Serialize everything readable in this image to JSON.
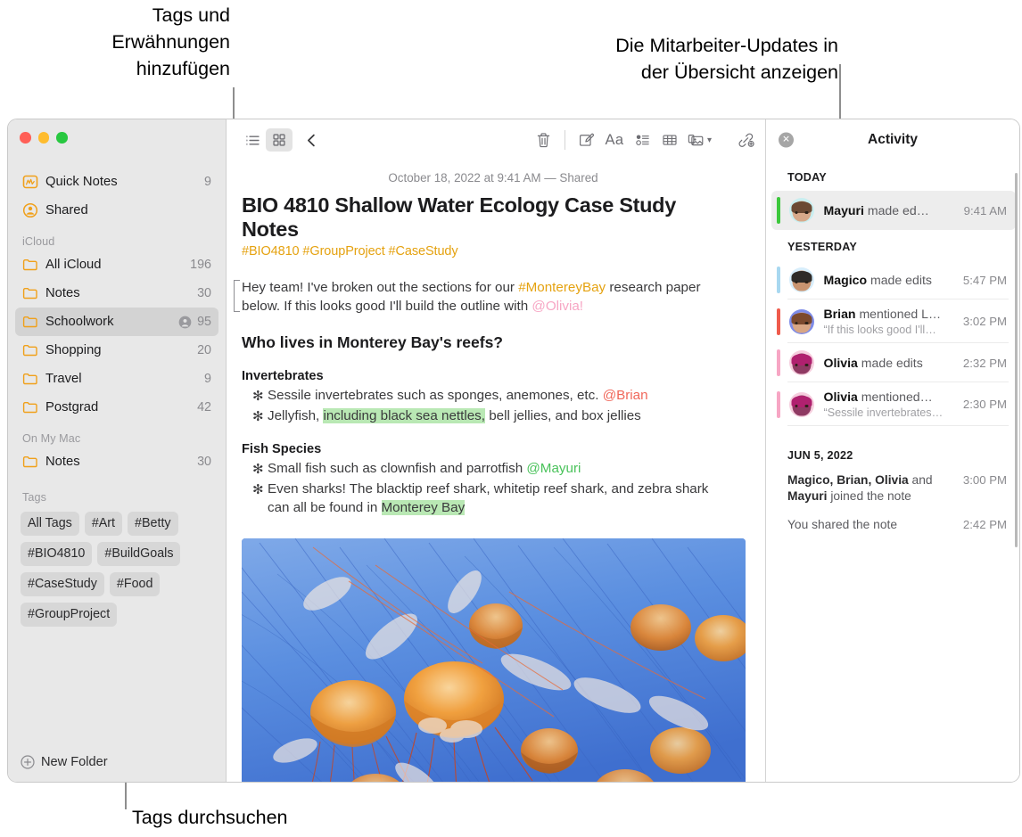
{
  "callouts": [
    {
      "id": "tags-mentions",
      "text": "Tags und\nErwähnungen\nhinzufügen"
    },
    {
      "id": "activity-overview",
      "text": "Die Mitarbeiter-Updates in\nder Übersicht anzeigen"
    },
    {
      "id": "browse-tags",
      "text": "Tags durchsuchen"
    }
  ],
  "window": {
    "traffic_lights": [
      "close",
      "minimize",
      "zoom"
    ]
  },
  "sidebar": {
    "top_items": [
      {
        "label": "Quick Notes",
        "count": "9",
        "icon": "quick-note-icon"
      },
      {
        "label": "Shared",
        "count": "",
        "icon": "shared-person-icon"
      }
    ],
    "groups": [
      {
        "title": "iCloud",
        "items": [
          {
            "label": "All iCloud",
            "count": "196",
            "icon": "folder-icon",
            "selected": false,
            "shared": false
          },
          {
            "label": "Notes",
            "count": "30",
            "icon": "folder-icon",
            "selected": false,
            "shared": false
          },
          {
            "label": "Schoolwork",
            "count": "95",
            "icon": "folder-icon",
            "selected": true,
            "shared": true
          },
          {
            "label": "Shopping",
            "count": "20",
            "icon": "folder-icon",
            "selected": false,
            "shared": false
          },
          {
            "label": "Travel",
            "count": "9",
            "icon": "folder-icon",
            "selected": false,
            "shared": false
          },
          {
            "label": "Postgrad",
            "count": "42",
            "icon": "folder-icon",
            "selected": false,
            "shared": false
          }
        ]
      },
      {
        "title": "On My Mac",
        "items": [
          {
            "label": "Notes",
            "count": "30",
            "icon": "folder-icon",
            "selected": false,
            "shared": false
          }
        ]
      }
    ],
    "tags_title": "Tags",
    "tags": [
      "All Tags",
      "#Art",
      "#Betty",
      "#BIO4810",
      "#BuildGoals",
      "#CaseStudy",
      "#Food",
      "#GroupProject"
    ],
    "new_folder_label": "New Folder"
  },
  "toolbar": {
    "left": [
      {
        "name": "list-view-icon",
        "active": false
      },
      {
        "name": "gallery-view-icon",
        "active": true
      },
      {
        "name": "back-chevron-icon",
        "active": false
      }
    ],
    "center": [
      {
        "name": "trash-icon"
      },
      {
        "name": "compose-icon"
      },
      {
        "name": "format-aa-icon",
        "label": "Aa"
      },
      {
        "name": "checklist-icon"
      },
      {
        "name": "table-icon"
      },
      {
        "name": "media-icon",
        "caret": true
      },
      {
        "name": "link-add-icon"
      }
    ],
    "right": [
      {
        "name": "lock-icon",
        "caret": true
      },
      {
        "name": "add-collaborator-icon"
      },
      {
        "name": "share-icon"
      },
      {
        "name": "search-icon"
      }
    ]
  },
  "note": {
    "date_line": "October 18, 2022 at 9:41 AM — Shared",
    "title": "BIO 4810 Shallow Water Ecology Case Study Notes",
    "tag_line": "#BIO4810 #GroupProject #CaseStudy",
    "intro": {
      "part1": "Hey team! I've broken out the sections for our ",
      "hashtag": "#MontereyBay",
      "part2": " research paper below. If this looks good I'll build the outline with ",
      "mention": "@Olivia!"
    },
    "heading": "Who lives in Monterey Bay's reefs?",
    "sections": [
      {
        "title": "Invertebrates",
        "bullets": [
          {
            "pre": "Sessile invertebrates such as sponges, anemones, etc. ",
            "mention": "@Brian",
            "mention_color": "red",
            "post": ""
          },
          {
            "pre": "Jellyfish, ",
            "highlight": "including black sea nettles,",
            "post": " bell jellies, and box jellies"
          }
        ]
      },
      {
        "title": "Fish Species",
        "bullets": [
          {
            "pre": "Small fish such as clownfish and parrotfish ",
            "mention": "@Mayuri",
            "mention_color": "green",
            "post": ""
          },
          {
            "pre": "Even sharks! The blacktip reef shark, whitetip reef shark, and zebra shark can all be found in ",
            "highlight": "Monterey Bay",
            "post": ""
          }
        ]
      }
    ],
    "image_alt": "jellyfish-photo"
  },
  "activity": {
    "title": "Activity",
    "close_icon": "close-icon",
    "sections": [
      {
        "label": "TODAY",
        "entries": [
          {
            "actor": "Mayuri",
            "action": " made ed…",
            "quote": "",
            "time": "9:41 AM",
            "bar_color": "#3cc83c",
            "avatar_bg": "#c9eef0",
            "avatar_skin": "#d7a98a",
            "avatar_hair": "#6b4a34",
            "selected": true
          }
        ]
      },
      {
        "label": "YESTERDAY",
        "entries": [
          {
            "actor": "Magico",
            "action": " made edits",
            "quote": "",
            "time": "5:47 PM",
            "bar_color": "#a8d8f0",
            "avatar_bg": "#d8eefb",
            "avatar_skin": "#c99470",
            "avatar_hair": "#2f2b28",
            "selected": false
          },
          {
            "actor": "Brian",
            "action": " mentioned L…",
            "quote": "“If this looks good I'll…",
            "time": "3:02 PM",
            "bar_color": "#ef5b4c",
            "avatar_bg": "#7e8ce8",
            "avatar_skin": "#d8a684",
            "avatar_hair": "#7c4a2e",
            "selected": false
          },
          {
            "actor": "Olivia",
            "action": " made edits",
            "quote": "",
            "time": "2:32 PM",
            "bar_color": "#f7a6c4",
            "avatar_bg": "#f6cede",
            "avatar_skin": "#8f3a63",
            "avatar_hair": "#b0216f",
            "selected": false
          },
          {
            "actor": "Olivia",
            "action": " mentioned…",
            "quote": "“Sessile invertebrates…",
            "time": "2:30 PM",
            "bar_color": "#f7a6c4",
            "avatar_bg": "#f6cede",
            "avatar_skin": "#8f3a63",
            "avatar_hair": "#b0216f",
            "selected": false
          }
        ]
      }
    ],
    "history": {
      "label": "JUN 5, 2022",
      "rows": [
        {
          "bold1": "Magico, Brian, Olivia",
          "mid": " and ",
          "bold2": "Mayuri",
          "tail": " joined the note",
          "time": "3:00 PM"
        },
        {
          "bold1": "",
          "mid": "",
          "bold2": "",
          "tail": "You shared the note",
          "time": "2:42 PM"
        }
      ]
    }
  },
  "colors": {
    "accent_orange": "#e5a210",
    "highlight_green": "#b9e8b4",
    "selection_grey": "#d3d3d3",
    "mention_pink": "#f7a6c4",
    "mention_red": "#f0675a",
    "mention_green": "#49c25a"
  }
}
